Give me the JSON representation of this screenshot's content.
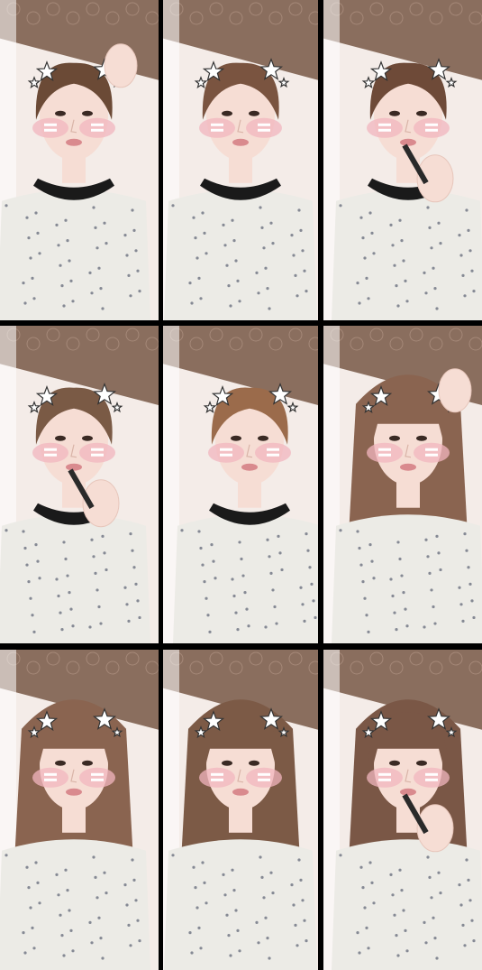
{
  "collage": {
    "frames": [
      {
        "index": 1,
        "scene": "pixie-hair-hand-raised",
        "hair": "short",
        "hair_color": "#6b4a36"
      },
      {
        "index": 2,
        "scene": "pixie-hair-talking",
        "hair": "short",
        "hair_color": "#7a5440"
      },
      {
        "index": 3,
        "scene": "pixie-hair-makeup-brush",
        "hair": "short",
        "hair_color": "#6e4a38"
      },
      {
        "index": 4,
        "scene": "pixie-hair-contour-brush",
        "hair": "short",
        "hair_color": "#7a5a45"
      },
      {
        "index": 5,
        "scene": "pixie-hair-head-tilt",
        "hair": "short",
        "hair_color": "#9b6b4b"
      },
      {
        "index": 6,
        "scene": "long-hair-adjusting",
        "hair": "long",
        "hair_color": "#8a6450"
      },
      {
        "index": 7,
        "scene": "long-hair-front",
        "hair": "long",
        "hair_color": "#8a6450"
      },
      {
        "index": 8,
        "scene": "long-hair-talking",
        "hair": "long",
        "hair_color": "#7c5a46"
      },
      {
        "index": 9,
        "scene": "long-hair-lipstick",
        "hair": "long",
        "hair_color": "#7a5746"
      }
    ],
    "colors": {
      "ceiling": "#8a6e5e",
      "wall": "#f4ece8",
      "skin": "#f6ddd4",
      "top": "#ecebe6",
      "cheek": "#f2b5bf",
      "dress": "#ecebe6"
    },
    "icons": [
      "star-sticker-icon",
      "blush-sticker-icon"
    ]
  }
}
